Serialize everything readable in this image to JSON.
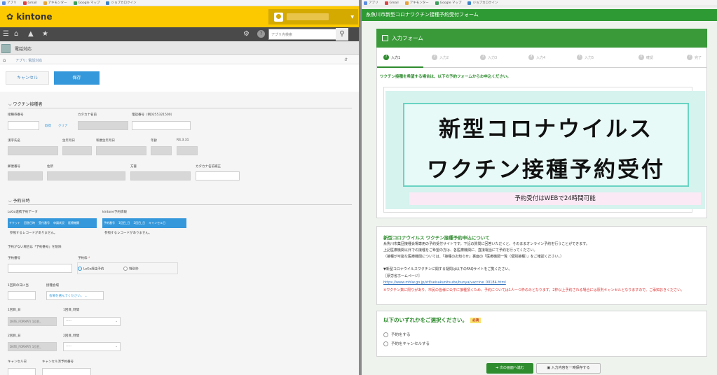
{
  "bookmarks": [
    "アプリ",
    "Gmail",
    "アキモンター",
    "Google マップ",
    "ジョブカロクイン"
  ],
  "kintone": {
    "logo": "kintone",
    "search_placeholder": "アプリ内検索",
    "app_title": "電話対応",
    "breadcrumb": "アプリ: 電話対応",
    "cancel_label": "キャンセル",
    "save_label": "保存",
    "section1": "ワクチン接種者",
    "fields": {
      "applicant_no": "接種券番号",
      "kana_name": "カタカナ名前",
      "phone": "電話番号（例0255321500）",
      "lookup_get": "取得",
      "lookup_clear": "クリア",
      "name": "漢字氏名",
      "birth": "生年月日",
      "wareki": "和暦生年月日",
      "age": "年齢",
      "age_date": "R4.3.31",
      "zip": "郵便番号",
      "address": "住所",
      "town": "方書",
      "kana_fix": "カタカナ名前補正"
    },
    "section2": "予約日時",
    "logo_table_label": "LoGo連携予約データ",
    "logo_table_cols": [
      "チケット",
      "回答日時",
      "受付番号",
      "申請状況",
      "医療機関"
    ],
    "kintone_table_label": "kintone予約情報",
    "kintone_table_cols": [
      "予約番号",
      "1回目_日",
      "2回目_日",
      "キャンセル日"
    ],
    "no_records": "参照するレコードがありません。",
    "reservation_no_hint": "予約がない場合は「予約番号」を削除",
    "reservation_no": "予約番号",
    "reservation_type": "予約枠",
    "required_mark": "*",
    "radio_logo": "LoGo経由予約",
    "radio_special": "特別枠",
    "interval": "1回目の日に当",
    "venue": "接種会場",
    "venue_placeholder": "会場を選んでください。",
    "dose1_date": "1回目_日",
    "dose1_time": "1回目_時間",
    "date_format": "DATE_FORMAT( 1回目_",
    "time_placeholder": "-----",
    "dose2_date": "2回目_日",
    "dose2_time": "2回目_時間",
    "date_format2": "DATE_FORMAT( 1回目_",
    "cancel_date": "キャンセル日",
    "cancel_no": "キャンセル済予約番号"
  },
  "form": {
    "title": "糸魚川市新型コロナワクチン接種予約受付フォーム",
    "card_title": "入力フォーム",
    "steps": [
      "入力1",
      "入力2",
      "入力3",
      "入力4",
      "入力5",
      "確認",
      "完了"
    ],
    "intro": "ワクチン接種を希望する場合は、以下の予約フォームからお申込ください。",
    "banner_line1": "新型コロナウイルス",
    "banner_line2": "ワクチン接種予約受付",
    "banner_note": "予約受付はWEBで24時間可能",
    "about_heading": "新型コロナウイルス ワクチン接種予約申込について",
    "about_1": "糸魚川市集団接種会場専用の予約受付サイトです。下記の質問に回答いただくと、そのままオンライン予約を行うことができます。",
    "about_2": "上記医療機関以外での接種をご希望の方は、各医療機関に、直接電話にて予約を行ってください。",
    "about_3": "（接種が可能な医療機関については、「接種のお知らせ」裏面の「医療機関一覧（個別接種）」をご確認ください。）",
    "faq_intro": "▼新型コロナウイルスワクチンに関する疑問は以下のFAQサイトをご覧ください。",
    "faq_site": "［厚労省ホームページ］",
    "faq_url": "https://www.mhlw.go.jp/stf/seisakunitsuite/bunya/vaccine_00184.html",
    "warn_1": "※ワクチン数に限りがあり、市民の皆様に公平に接種頂くため、予約については1人一つ枠のみとなります。2枠以上予約される場合には原則キャンセルとなりますので、ご承知おきください。",
    "select_heading": "以下のいずれかをご選択ください。",
    "required": "必須",
    "option_reserve": "予約をする",
    "option_cancel": "予約をキャンセルする",
    "next_button": "次の画面へ進む",
    "save_button": "入力内容を一時保存する"
  },
  "colors": {
    "kintone_yellow": "#fcc800",
    "kintone_blue": "#3498db",
    "form_green": "#2e9a33"
  }
}
